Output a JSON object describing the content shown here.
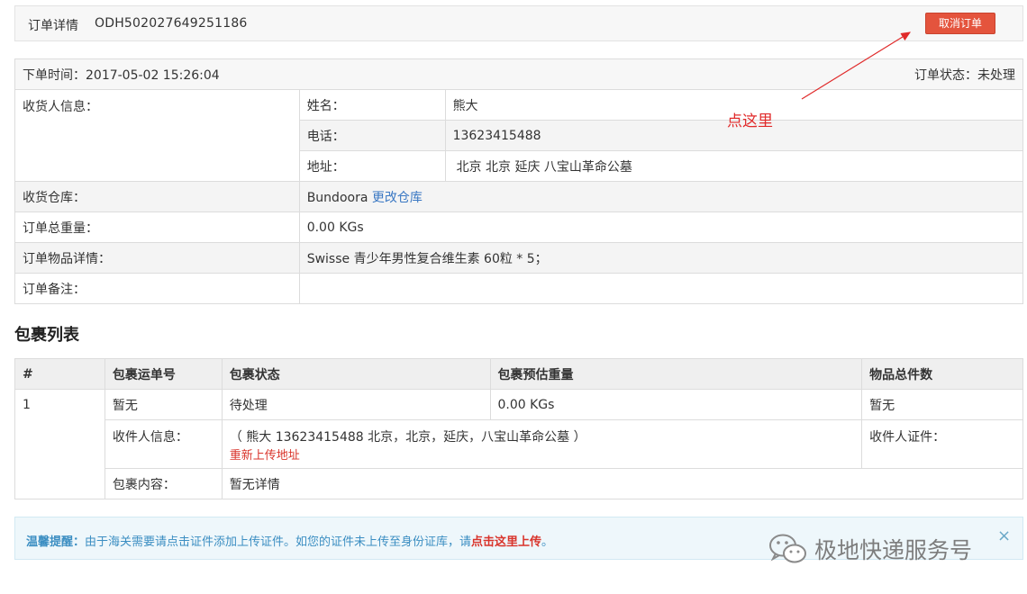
{
  "header": {
    "title": "订单详情",
    "order_no": "ODH502027649251186",
    "cancel_label": "取消订单"
  },
  "order": {
    "time": "下单时间：2017-05-02 15:26:04",
    "status": "订单状态：未处理",
    "receiver_label": "收货人信息：",
    "name_label": "姓名：",
    "name_value": "熊大",
    "phone_label": "电话：",
    "phone_value": "13623415488",
    "address_label": "地址：",
    "address_value": "北京 北京 延庆 八宝山革命公墓",
    "warehouse_label": "收货仓库：",
    "warehouse_value": "Bundoora",
    "change_warehouse": "更改仓库",
    "weight_label": "订单总重量：",
    "weight_value": "0.00 KGs",
    "items_label": "订单物品详情：",
    "items_value": "Swisse 青少年男性复合维生素 60粒 * 5；",
    "note_label": "订单备注：",
    "note_value": ""
  },
  "annotation": {
    "text": "点这里"
  },
  "packages": {
    "title": "包裹列表",
    "columns": [
      "#",
      "包裹运单号",
      "包裹状态",
      "包裹预估重量",
      "物品总件数"
    ],
    "rows": [
      {
        "index": "1",
        "tracking": "暂无",
        "status": "待处理",
        "weight": "0.00 KGs",
        "count": "暂无",
        "recipient_label": "收件人信息：",
        "recipient_value": "（ 熊大  13623415488  北京，北京，延庆，八宝山革命公墓 ）",
        "reupload": "重新上传地址",
        "id_label": "收件人证件：",
        "content_label": "包裹内容：",
        "content_value": "暂无详情"
      }
    ]
  },
  "tip": {
    "prefix": "温馨提醒：",
    "body": "由于海关需要请点击证件添加上传证件。如您的证件未上传至身份证库，请",
    "link": "点击这里上传",
    "suffix": "。",
    "close": "×"
  },
  "watermark": {
    "text": "极地快递服务号",
    "icon": "wechat-icon"
  },
  "colors": {
    "accent_red": "#e4543d",
    "link_blue": "#3a78c3",
    "tip_bg": "#eef7fb"
  }
}
